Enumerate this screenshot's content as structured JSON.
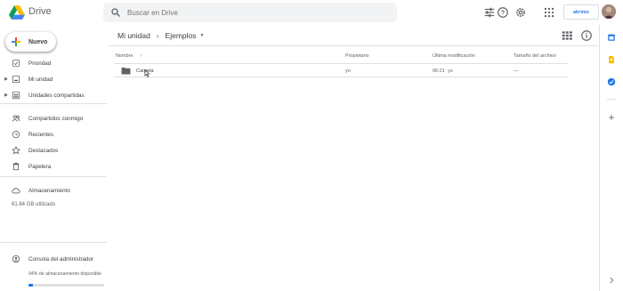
{
  "app": {
    "name": "Drive"
  },
  "search": {
    "placeholder": "Buscar en Drive"
  },
  "header_icons": [
    "help-icon",
    "settings-icon",
    "apps-grid-icon"
  ],
  "brand": {
    "text": "abrimo"
  },
  "sidebar": {
    "new_label": "Nuevo",
    "items": [
      {
        "label": "Prioridad",
        "icon": "check-circle-icon"
      },
      {
        "label": "Mi unidad",
        "icon": "my-drive-icon"
      },
      {
        "label": "Unidades compartidas",
        "icon": "shared-drives-icon"
      },
      {
        "label": "Compartidos conmigo",
        "icon": "people-icon"
      },
      {
        "label": "Recientes",
        "icon": "clock-icon"
      },
      {
        "label": "Destacados",
        "icon": "star-icon"
      },
      {
        "label": "Papelera",
        "icon": "trash-icon"
      },
      {
        "label": "Almacenamiento",
        "icon": "cloud-icon"
      }
    ],
    "storage_used": "61.84 GB utilizado",
    "admin_label": "Consola del administrador",
    "available": "94% de almacenamiento disponible",
    "storage_fill_percent": 6
  },
  "breadcrumb": {
    "root": "Mi unidad",
    "current": "Ejemplos"
  },
  "table": {
    "headers": {
      "name": "Nombre",
      "owner": "Propietario",
      "modified": "Última modificación",
      "size": "Tamaño del archivo"
    },
    "rows": [
      {
        "name": "Carpeta",
        "owner": "yo",
        "modified": "06:21",
        "modified_by": "yo",
        "size": "—"
      }
    ]
  },
  "colors": {
    "accent": "#1a73e8",
    "icon_gray": "#5f6368",
    "text": "#3c4043"
  }
}
